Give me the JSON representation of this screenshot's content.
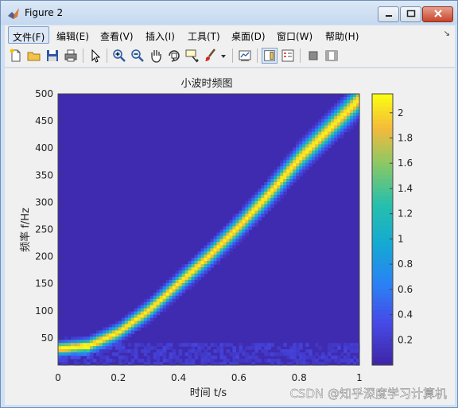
{
  "window": {
    "title": "Figure 2"
  },
  "menu": {
    "items": [
      {
        "label": "文件(F)",
        "name": "menu-file"
      },
      {
        "label": "编辑(E)",
        "name": "menu-edit"
      },
      {
        "label": "查看(V)",
        "name": "menu-view"
      },
      {
        "label": "插入(I)",
        "name": "menu-insert"
      },
      {
        "label": "工具(T)",
        "name": "menu-tools"
      },
      {
        "label": "桌面(D)",
        "name": "menu-desktop"
      },
      {
        "label": "窗口(W)",
        "name": "menu-window"
      },
      {
        "label": "帮助(H)",
        "name": "menu-help"
      }
    ],
    "overflow_glyph": "↘"
  },
  "toolbar": {
    "icons": [
      "new-figure-icon",
      "open-file-icon",
      "save-icon",
      "print-icon",
      "edit-plot-arrow-icon",
      "zoom-in-icon",
      "zoom-out-icon",
      "pan-hand-icon",
      "rotate-3d-icon",
      "data-cursor-icon",
      "brush-icon",
      "dropdown-arrow-icon",
      "link-plot-icon",
      "colorbar-toggle-icon",
      "legend-toggle-icon",
      "hide-plot-tools-icon",
      "show-plot-tools-icon"
    ]
  },
  "chart_data": {
    "type": "heatmap",
    "title": "小波时频图",
    "xlabel": "时间 t/s",
    "ylabel": "频率 f/Hz",
    "xlim": [
      0,
      1
    ],
    "ylim": [
      0,
      500
    ],
    "xticks": [
      "0",
      "0.2",
      "0.4",
      "0.6",
      "0.8",
      "1"
    ],
    "yticks": [
      "50",
      "100",
      "150",
      "200",
      "250",
      "300",
      "350",
      "400",
      "450",
      "500"
    ],
    "colormap": "parula",
    "colorbar": {
      "range": [
        0,
        2.15
      ],
      "ticks": [
        "0.2",
        "0.4",
        "0.6",
        "0.8",
        "1",
        "1.2",
        "1.4",
        "1.6",
        "1.8",
        "2"
      ]
    },
    "ridge": {
      "description_points_t": [
        0,
        0.1,
        0.2,
        0.3,
        0.4,
        0.5,
        0.6,
        0.7,
        0.8,
        0.9,
        1.0
      ],
      "description_points_f": [
        30,
        35,
        60,
        100,
        150,
        200,
        255,
        315,
        380,
        435,
        490
      ],
      "peak_magnitude": 2.1
    },
    "colors": {
      "background_low": "#3e26a8",
      "ridge_mid": "#2fbeb2",
      "ridge_peak": "#fdea25"
    }
  },
  "watermark": "CSDN @知乎深度学习计算机"
}
